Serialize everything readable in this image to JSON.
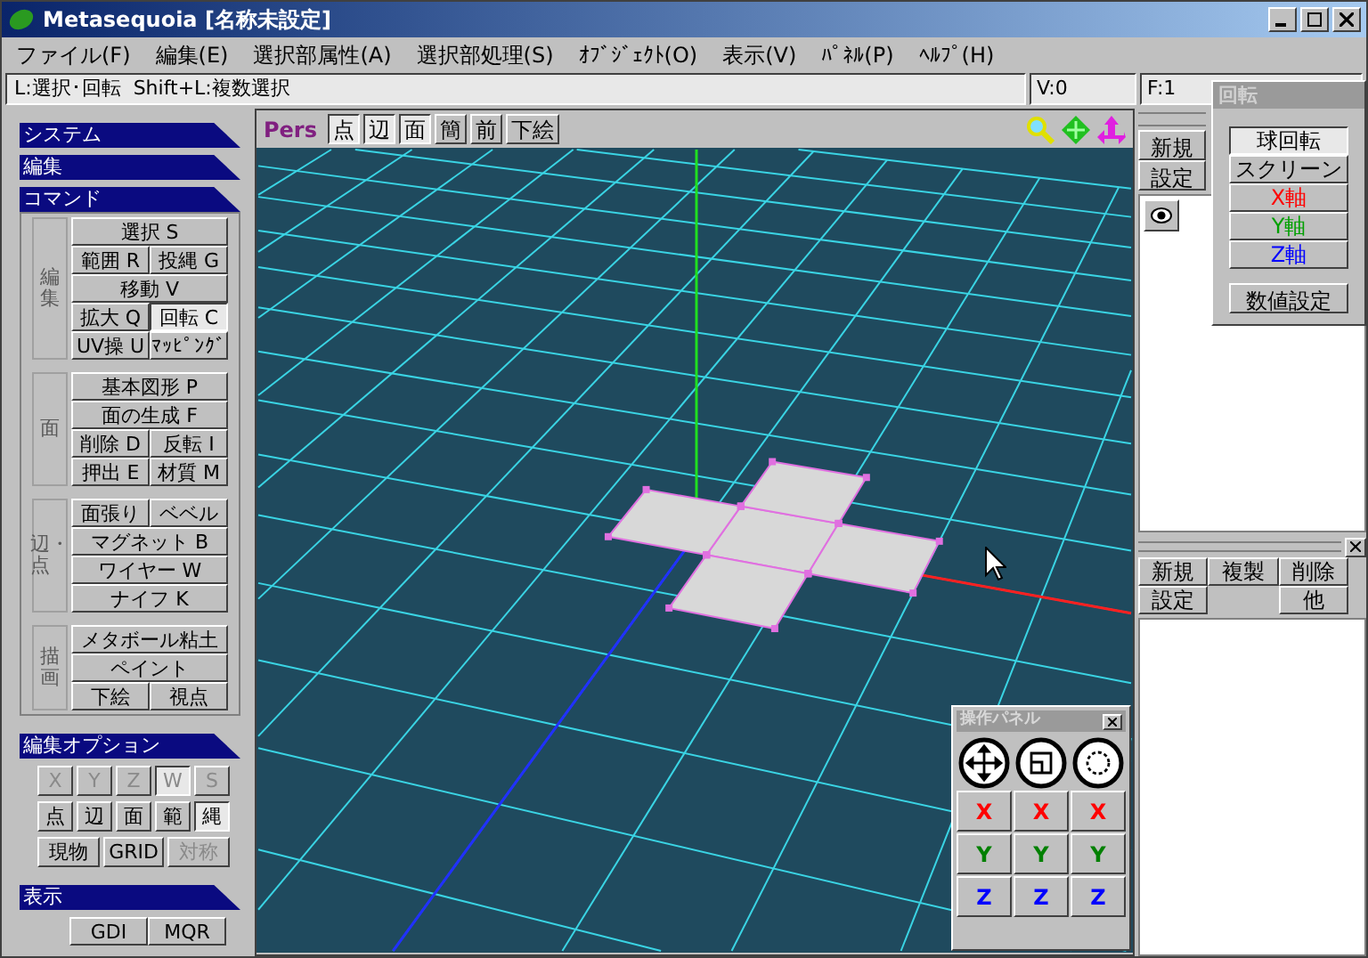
{
  "window": {
    "title": "Metasequoia [名称未設定]"
  },
  "menu": [
    "ファイル(F)",
    "編集(E)",
    "選択部属性(A)",
    "選択部処理(S)",
    "ｵﾌﾞｼﾞｪｸﾄ(O)",
    "表示(V)",
    "ﾊﾟﾈﾙ(P)",
    "ﾍﾙﾌﾟ(H)"
  ],
  "status_bar": {
    "hint": "L:選択･回転  Shift+L:複数選択",
    "vertices": "V:0",
    "faces": "F:1"
  },
  "side_panel": {
    "headers": [
      "システム",
      "編集"
    ],
    "commands": {
      "title": "コマンド",
      "groups": [
        {
          "label": "編集",
          "rows": [
            [
              {
                "label": "選択 S",
                "selected": false
              }
            ],
            [
              {
                "label": "範囲 R",
                "selected": false
              },
              {
                "label": "投縄 G",
                "selected": false
              }
            ],
            [
              {
                "label": "移動 V",
                "selected": false
              }
            ],
            [
              {
                "label": "拡大 Q",
                "selected": false
              },
              {
                "label": "回転 C",
                "selected": true
              }
            ],
            [
              {
                "label": "UV操 U",
                "selected": false
              },
              {
                "label": "ﾏｯﾋﾟﾝｸﾞ",
                "selected": false
              }
            ]
          ]
        },
        {
          "label": "面",
          "rows": [
            [
              {
                "label": "基本図形 P",
                "selected": false
              }
            ],
            [
              {
                "label": "面の生成 F",
                "selected": false
              }
            ],
            [
              {
                "label": "削除 D",
                "selected": false
              },
              {
                "label": "反転 I",
                "selected": false
              }
            ],
            [
              {
                "label": "押出 E",
                "selected": false
              },
              {
                "label": "材質 M",
                "selected": false
              }
            ]
          ]
        },
        {
          "label": "辺・点",
          "rows": [
            [
              {
                "label": "面張り",
                "selected": false
              },
              {
                "label": "ベベル",
                "selected": false
              }
            ],
            [
              {
                "label": "マグネット B",
                "selected": false
              }
            ],
            [
              {
                "label": "ワイヤー W",
                "selected": false
              }
            ],
            [
              {
                "label": "ナイフ K",
                "selected": false
              }
            ]
          ]
        },
        {
          "label": "描画",
          "rows": [
            [
              {
                "label": "メタボール粘土",
                "selected": false
              }
            ],
            [
              {
                "label": "ペイント",
                "selected": false
              }
            ],
            [
              {
                "label": "下絵",
                "selected": false
              },
              {
                "label": "視点",
                "selected": false
              }
            ]
          ]
        }
      ]
    },
    "edit_options": {
      "title": "編集オプション",
      "axis_locks": [
        {
          "label": "X",
          "selected": false,
          "disabled": true
        },
        {
          "label": "Y",
          "selected": false,
          "disabled": true
        },
        {
          "label": "Z",
          "selected": false,
          "disabled": true
        },
        {
          "label": "W",
          "selected": true,
          "disabled": true
        },
        {
          "label": "S",
          "selected": false,
          "disabled": true
        }
      ],
      "select_modes": [
        {
          "label": "点",
          "selected": false,
          "disabled": false
        },
        {
          "label": "辺",
          "selected": false,
          "disabled": false
        },
        {
          "label": "面",
          "selected": false,
          "disabled": false
        },
        {
          "label": "範",
          "selected": false,
          "disabled": false
        },
        {
          "label": "縄",
          "selected": true,
          "disabled": false
        }
      ],
      "toggles": [
        {
          "label": "現物",
          "selected": false,
          "disabled": false
        },
        {
          "label": "GRID",
          "selected": false,
          "disabled": false
        },
        {
          "label": "対称",
          "selected": false,
          "disabled": true
        }
      ]
    },
    "display": {
      "title": "表示",
      "rows": [
        [
          {
            "label": "GDI",
            "selected": false
          },
          {
            "label": "MQR",
            "selected": false
          }
        ]
      ]
    }
  },
  "viewport": {
    "projection": "Pers",
    "view_buttons": [
      {
        "label": "点",
        "selected": true
      },
      {
        "label": "辺",
        "selected": true
      },
      {
        "label": "面",
        "selected": true
      },
      {
        "label": "簡",
        "selected": false
      },
      {
        "label": "前",
        "selected": false
      },
      {
        "label": "下絵",
        "selected": false
      }
    ]
  },
  "rotate_panel": {
    "title": "回転",
    "modes": [
      {
        "label": "球回転",
        "selected": true,
        "color": "#000000"
      },
      {
        "label": "スクリーン",
        "selected": false,
        "color": "#000000"
      },
      {
        "label": "X軸",
        "selected": false,
        "color": "#ff0000"
      },
      {
        "label": "Y軸",
        "selected": false,
        "color": "#00a000"
      },
      {
        "label": "Z軸",
        "selected": false,
        "color": "#0000ff"
      }
    ],
    "numeric_button": "数値設定"
  },
  "object_panel": {
    "buttons": [
      "新規",
      "設定"
    ],
    "objects": [
      {
        "visible": true
      }
    ]
  },
  "material_panel": {
    "buttons": [
      "新規",
      "複製",
      "削除",
      "設定",
      "他"
    ]
  },
  "operation_panel": {
    "title": "操作パネル",
    "axes": [
      {
        "color": "#ff0000",
        "labels": [
          "X",
          "X",
          "X"
        ]
      },
      {
        "color": "#008000",
        "labels": [
          "Y",
          "Y",
          "Y"
        ]
      },
      {
        "color": "#0000ff",
        "labels": [
          "Z",
          "Z",
          "Z"
        ]
      }
    ]
  }
}
